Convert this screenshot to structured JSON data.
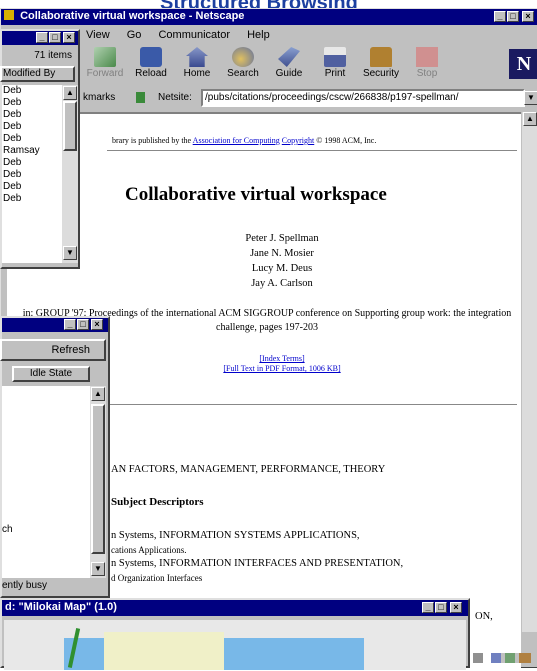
{
  "header_banner": "Structured Browsing",
  "netscape": {
    "title": "Collaborative virtual workspace - Netscape",
    "menu": [
      "View",
      "Go",
      "Communicator",
      "Help"
    ],
    "toolbar": [
      "Forward",
      "Reload",
      "Home",
      "Search",
      "Guide",
      "Print",
      "Security",
      "Stop"
    ],
    "bookmarks_label": "kmarks",
    "netsite_label": "Netsite:",
    "url": "/pubs/citations/proceedings/cscw/266838/p197-spellman/",
    "doc": {
      "pub_line": "brary is published by the",
      "acm_link": "Association for Computing",
      "copyright_link": "Copyright",
      "copyright_rest": "© 1998 ACM, Inc.",
      "title": "Collaborative virtual workspace",
      "authors": [
        "Peter J. Spellman",
        "Jane N. Mosier",
        "Lucy M. Deus",
        "Jay A. Carlson"
      ],
      "citation": "in: GROUP '97: Proceedings of the international ACM SIGGROUP conference on Supporting group work: the integration challenge, pages 197-203",
      "index_terms": "[Index Terms]",
      "full_text": "[Full Text in PDF Format, 1006 KB]",
      "general_terms": "AN FACTORS, MANAGEMENT, PERFORMANCE, THEORY",
      "subject_heading": "Subject Descriptors",
      "subject_lines": [
        "n Systems, INFORMATION SYSTEMS APPLICATIONS,",
        "cations Applications.",
        "n Systems, INFORMATION INTERFACES AND PRESENTATION,",
        "d Organization Interfaces",
        "ON,"
      ]
    }
  },
  "file_window": {
    "count": "71 items",
    "column": "Modified By",
    "rows": [
      "Deb",
      "Deb",
      "Deb",
      "Deb",
      "Deb",
      "Ramsay",
      "Deb",
      "Deb",
      "Deb",
      "Deb"
    ]
  },
  "status_window": {
    "refresh": "Refresh",
    "state": "Idle State",
    "item": "ch",
    "status_text": "ently busy"
  },
  "map_window": {
    "title": "d: \"Milokai Map\" (1.0)"
  }
}
